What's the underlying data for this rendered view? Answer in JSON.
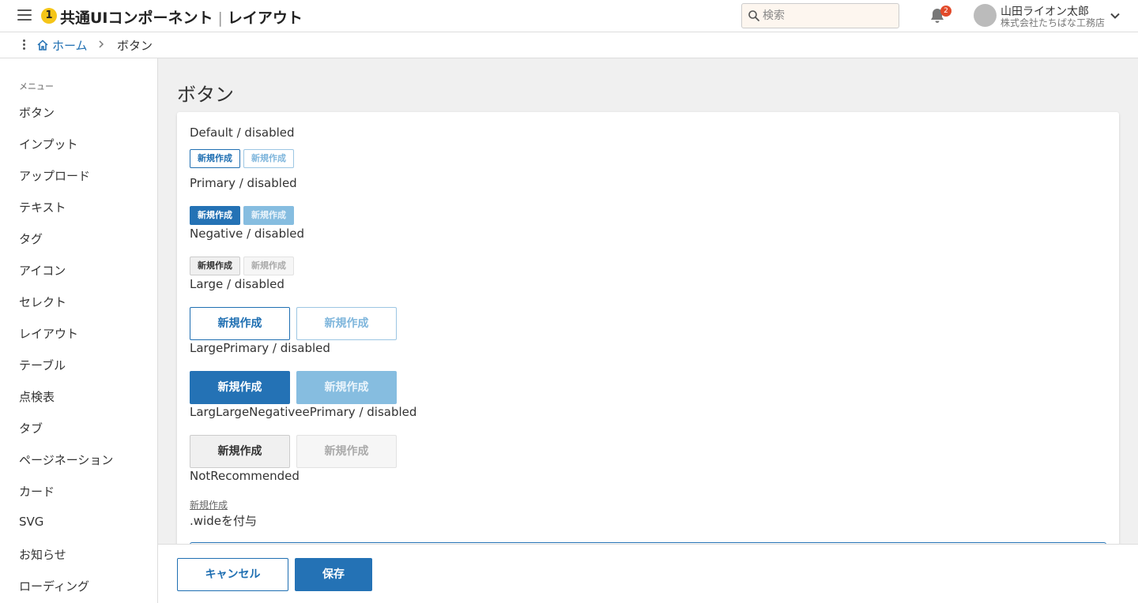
{
  "header": {
    "logo_glyph": "1",
    "app_name": "共通UIコンポーネント",
    "section": "レイアウト",
    "search_placeholder": "検索",
    "notification_count": "2",
    "user_name": "山田ライオン太郎",
    "user_company": "株式会社たちばな工務店"
  },
  "breadcrumb": {
    "home": "ホーム",
    "current": "ボタン"
  },
  "sidebar": {
    "label": "メニュー",
    "items": [
      "ボタン",
      "インプット",
      "アップロード",
      "テキスト",
      "タグ",
      "アイコン",
      "セレクト",
      "レイアウト",
      "テーブル",
      "点検表",
      "タブ",
      "ページネーション",
      "カード",
      "SVG",
      "お知らせ",
      "ローディング"
    ]
  },
  "main": {
    "title": "ボタン",
    "sections": {
      "default": "Default / disabled",
      "primary": "Primary / disabled",
      "negative": "Negative / disabled",
      "large": "Large / disabled",
      "large_primary": "LargePrimary / disabled",
      "large_negative": "LargLargeNegativeePrimary / disabled",
      "not_recommended": "NotRecommended",
      "wide": ".wideを付与"
    },
    "button_label": "新規作成"
  },
  "footer": {
    "cancel": "キャンセル",
    "save": "保存"
  },
  "colors": {
    "accent": "#2472b5",
    "accent_disabled": "#86bde0",
    "badge": "#e24a2a",
    "logo": "#f5c518",
    "search_bg": "#fdf6ef",
    "main_bg": "#f0f0f0"
  }
}
